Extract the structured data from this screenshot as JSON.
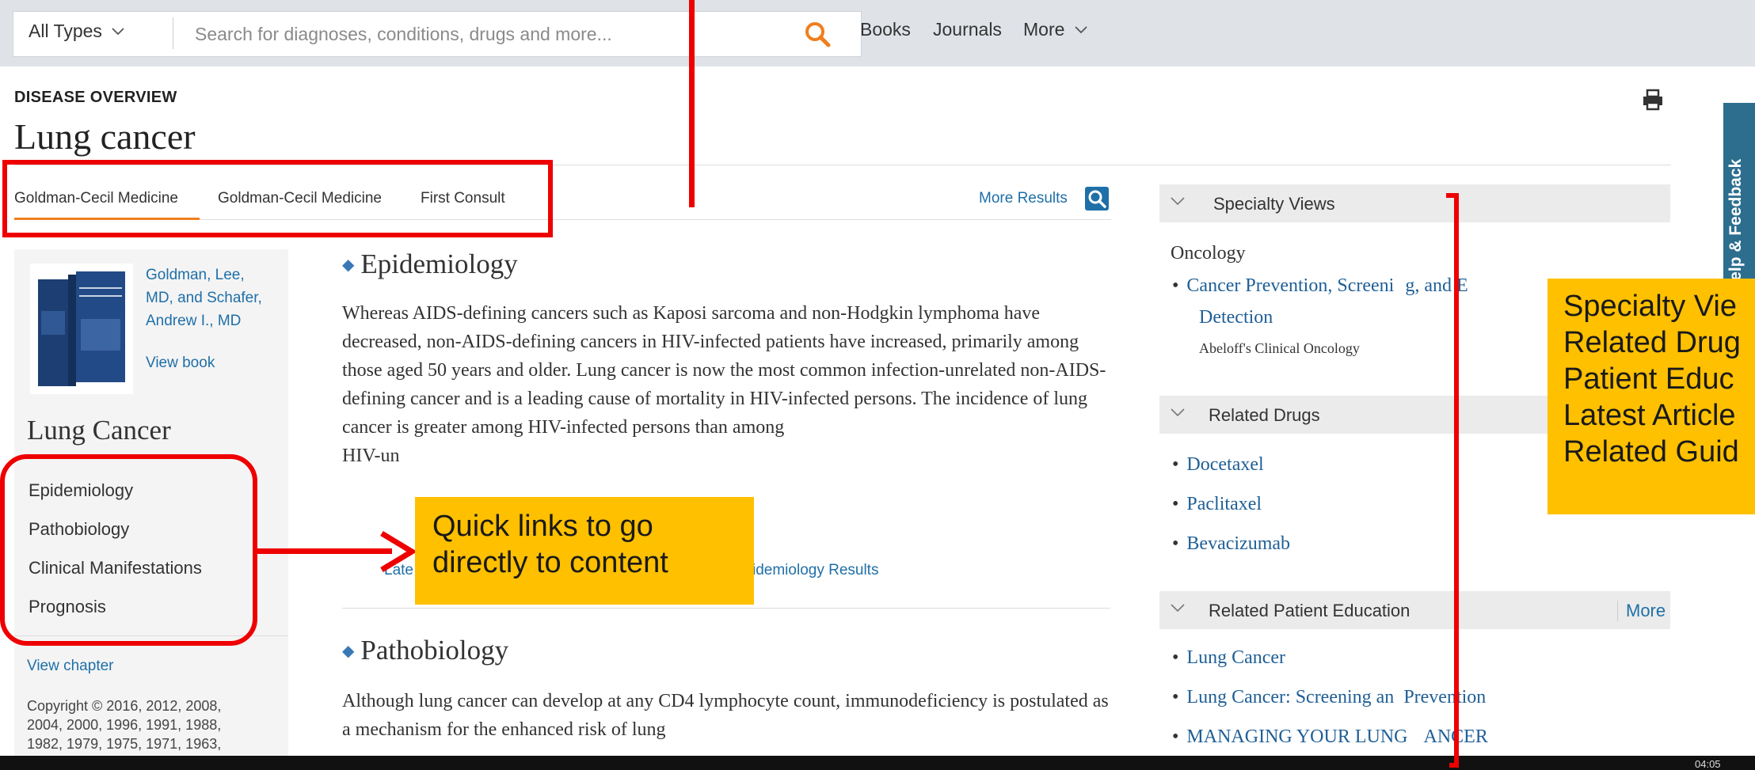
{
  "search": {
    "type_label": "All Types",
    "placeholder": "Search for diagnoses, conditions, drugs and more..."
  },
  "nav": {
    "books": "Books",
    "journals": "Journals",
    "more": "More"
  },
  "header": {
    "overview_label": "DISEASE OVERVIEW",
    "title": "Lung cancer"
  },
  "source_tabs": [
    "Goldman-Cecil Medicine",
    "Goldman-Cecil Medicine",
    "First Consult"
  ],
  "more_results": "More Results",
  "left": {
    "authors_line1": "Goldman, Lee,",
    "authors_line2": "MD, and Schafer,",
    "authors_line3": "Andrew I., MD",
    "view_book": "View book",
    "chapter_title": "Lung Cancer",
    "toc": [
      "Epidemiology",
      "Pathobiology",
      "Clinical Manifestations",
      "Prognosis"
    ],
    "view_chapter": "View chapter",
    "copyright_l1": "Copyright © 2016, 2012, 2008,",
    "copyright_l2": "2004, 2000, 1996, 1991, 1988,",
    "copyright_l3": "1982, 1979, 1975, 1971, 1963,"
  },
  "main": {
    "epi_heading": "Epidemiology",
    "epi_text": "Whereas AIDS-defining cancers such as Kaposi sarcoma and non-Hodgkin lymphoma have decreased, non-AIDS-defining cancers in HIV-infected patients have increased, primarily among those aged 50 years and older. Lung cancer is now the most common infection-unrelated non-AIDS-defining cancer and is a leading cause of mortality in HIV-infected persons. The incidence of lung cancer is greater among HIV-infected persons than among",
    "epi_text_tail": "HIV-un",
    "latest_link": "Late",
    "epi_results": "idemiology Results",
    "patho_heading": "Pathobiology",
    "patho_text": "Although lung cancer can develop at any CD4 lymphocyte count, immunodeficiency is postulated as a mechanism for the enhanced risk of lung"
  },
  "rail": {
    "specialty_title": "Specialty Views",
    "oncology": "Oncology",
    "specialty_link_1": "Cancer Prevention, Screeni",
    "specialty_link_1b": "g, and E",
    "specialty_link_2": "Detection",
    "specialty_source": "Abeloff's Clinical Oncology",
    "drugs_title": "Related Drugs",
    "drugs": [
      "Docetaxel",
      "Paclitaxel",
      "Bevacizumab"
    ],
    "pe_title": "Related Patient Education",
    "pe_more": "More",
    "pe_items": [
      "Lung Cancer",
      "Lung Cancer: Screening and Prevention",
      "MANAGING YOUR LUNG CANCER"
    ],
    "pe_item2a": "Lung Cancer: Screening an",
    "pe_item2b": "Prevention",
    "pe_item3a": "MANAGING YOUR LUNG ",
    "pe_item3b": "ANCER"
  },
  "feedback": "Help & Feedback",
  "taskbar_clock": "04:05",
  "annotations": {
    "quick_links_l1": "Quick links to go",
    "quick_links_l2": "directly to content",
    "right_callout": [
      "Specialty Vie",
      "Related Drug",
      "Patient Educ",
      "Latest Article",
      "Related Guid"
    ]
  },
  "colors": {
    "accent": "#f07f1e",
    "link": "#1f6fa8",
    "annotation_red": "#ee0000",
    "callout_fill": "#ffc000"
  }
}
